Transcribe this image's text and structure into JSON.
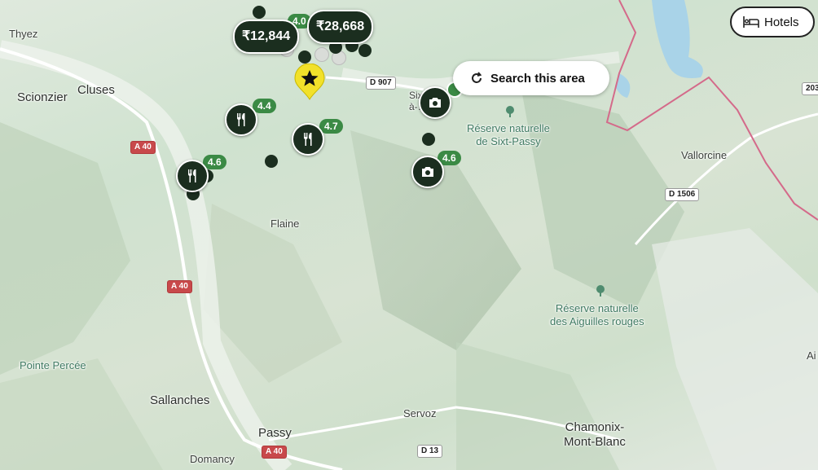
{
  "colors": {
    "pin": "#1b2e1f",
    "rating_badge": "#3b8a45",
    "favorite_pin": "#f2e12a",
    "border_line": "#d46a8a",
    "road_a": "#c8494b",
    "water": "#a9d3e8"
  },
  "controls": {
    "search_area_label": "Search this area",
    "hotels_label": "Hotels"
  },
  "places": [
    {
      "key": "thyez",
      "label": "Thyez"
    },
    {
      "key": "cluses",
      "label": "Cluses"
    },
    {
      "key": "scionzier",
      "label": "Scionzier"
    },
    {
      "key": "flaine",
      "label": "Flaine"
    },
    {
      "key": "vallorcine",
      "label": "Vallorcine"
    },
    {
      "key": "pointe_percee",
      "label": "Pointe Percée"
    },
    {
      "key": "sallanches",
      "label": "Sallanches"
    },
    {
      "key": "passy",
      "label": "Passy"
    },
    {
      "key": "servoz",
      "label": "Servoz"
    },
    {
      "key": "domancy",
      "label": "Domancy"
    },
    {
      "key": "chamonix",
      "label": "Chamonix-\nMont-Blanc"
    },
    {
      "key": "sixt",
      "label": "Sixt-\nà-…al"
    },
    {
      "key": "ai",
      "label": "Ai"
    }
  ],
  "parks": [
    {
      "label": "Réserve naturelle\nde Sixt-Passy"
    },
    {
      "label": "Réserve naturelle\ndes Aiguilles rouges"
    }
  ],
  "roads": [
    "D 907",
    "A 40",
    "A 40",
    "A 40",
    "D 1506",
    "D 13",
    "203"
  ],
  "ratings": [
    "4.0",
    "4.4",
    "4.7",
    "4.6",
    "4.6"
  ],
  "prices": [
    "₹12,844",
    "₹28,668"
  ],
  "icons": {
    "restaurant": "fork-knife-icon",
    "camera": "camera-icon",
    "favorite": "star-icon",
    "bed": "bed-icon",
    "search": "refresh-search-icon",
    "park": "tree-icon"
  }
}
